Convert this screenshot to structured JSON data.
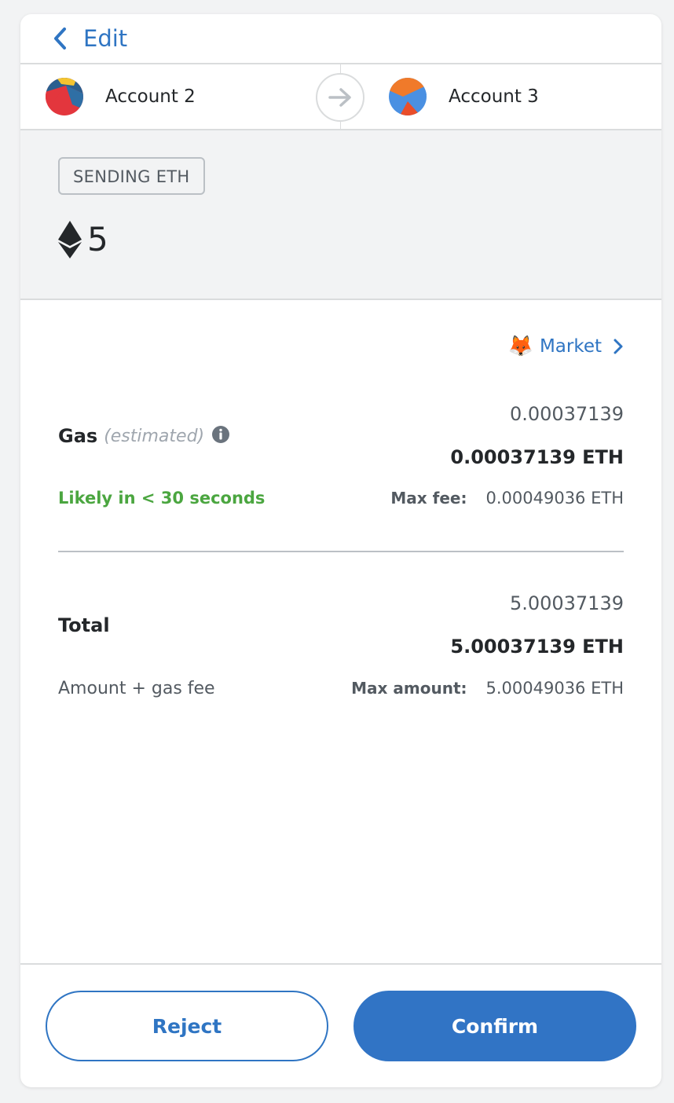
{
  "header": {
    "edit_label": "Edit"
  },
  "accounts": {
    "from_name": "Account 2",
    "to_name": "Account 3"
  },
  "sending": {
    "badge": "SENDING ETH",
    "amount": "5"
  },
  "gas": {
    "market_label": "Market",
    "title": "Gas",
    "estimated": "(estimated)",
    "fiat_value": "0.00037139",
    "eth_value": "0.00037139 ETH",
    "likely": "Likely in < 30 seconds",
    "max_fee_label": "Max fee:",
    "max_fee_value": "0.00049036 ETH"
  },
  "total": {
    "title": "Total",
    "fiat_value": "5.00037139",
    "eth_value": "5.00037139 ETH",
    "sub_label": "Amount + gas fee",
    "max_amount_label": "Max amount:",
    "max_amount_value": "5.00049036 ETH"
  },
  "footer": {
    "reject_label": "Reject",
    "confirm_label": "Confirm"
  },
  "colors": {
    "accent": "#2f75c3",
    "confirm_bg": "#3174c5",
    "success": "#4ba640",
    "text_primary": "#24272a",
    "text_secondary": "#535a61",
    "page_bg": "#f2f3f4"
  },
  "icons": {
    "back": "chevron-left-icon",
    "arrow": "arrow-right-icon",
    "eth": "ethereum-icon",
    "market": "fox-icon",
    "market_chevron": "chevron-right-icon",
    "info": "info-icon"
  }
}
